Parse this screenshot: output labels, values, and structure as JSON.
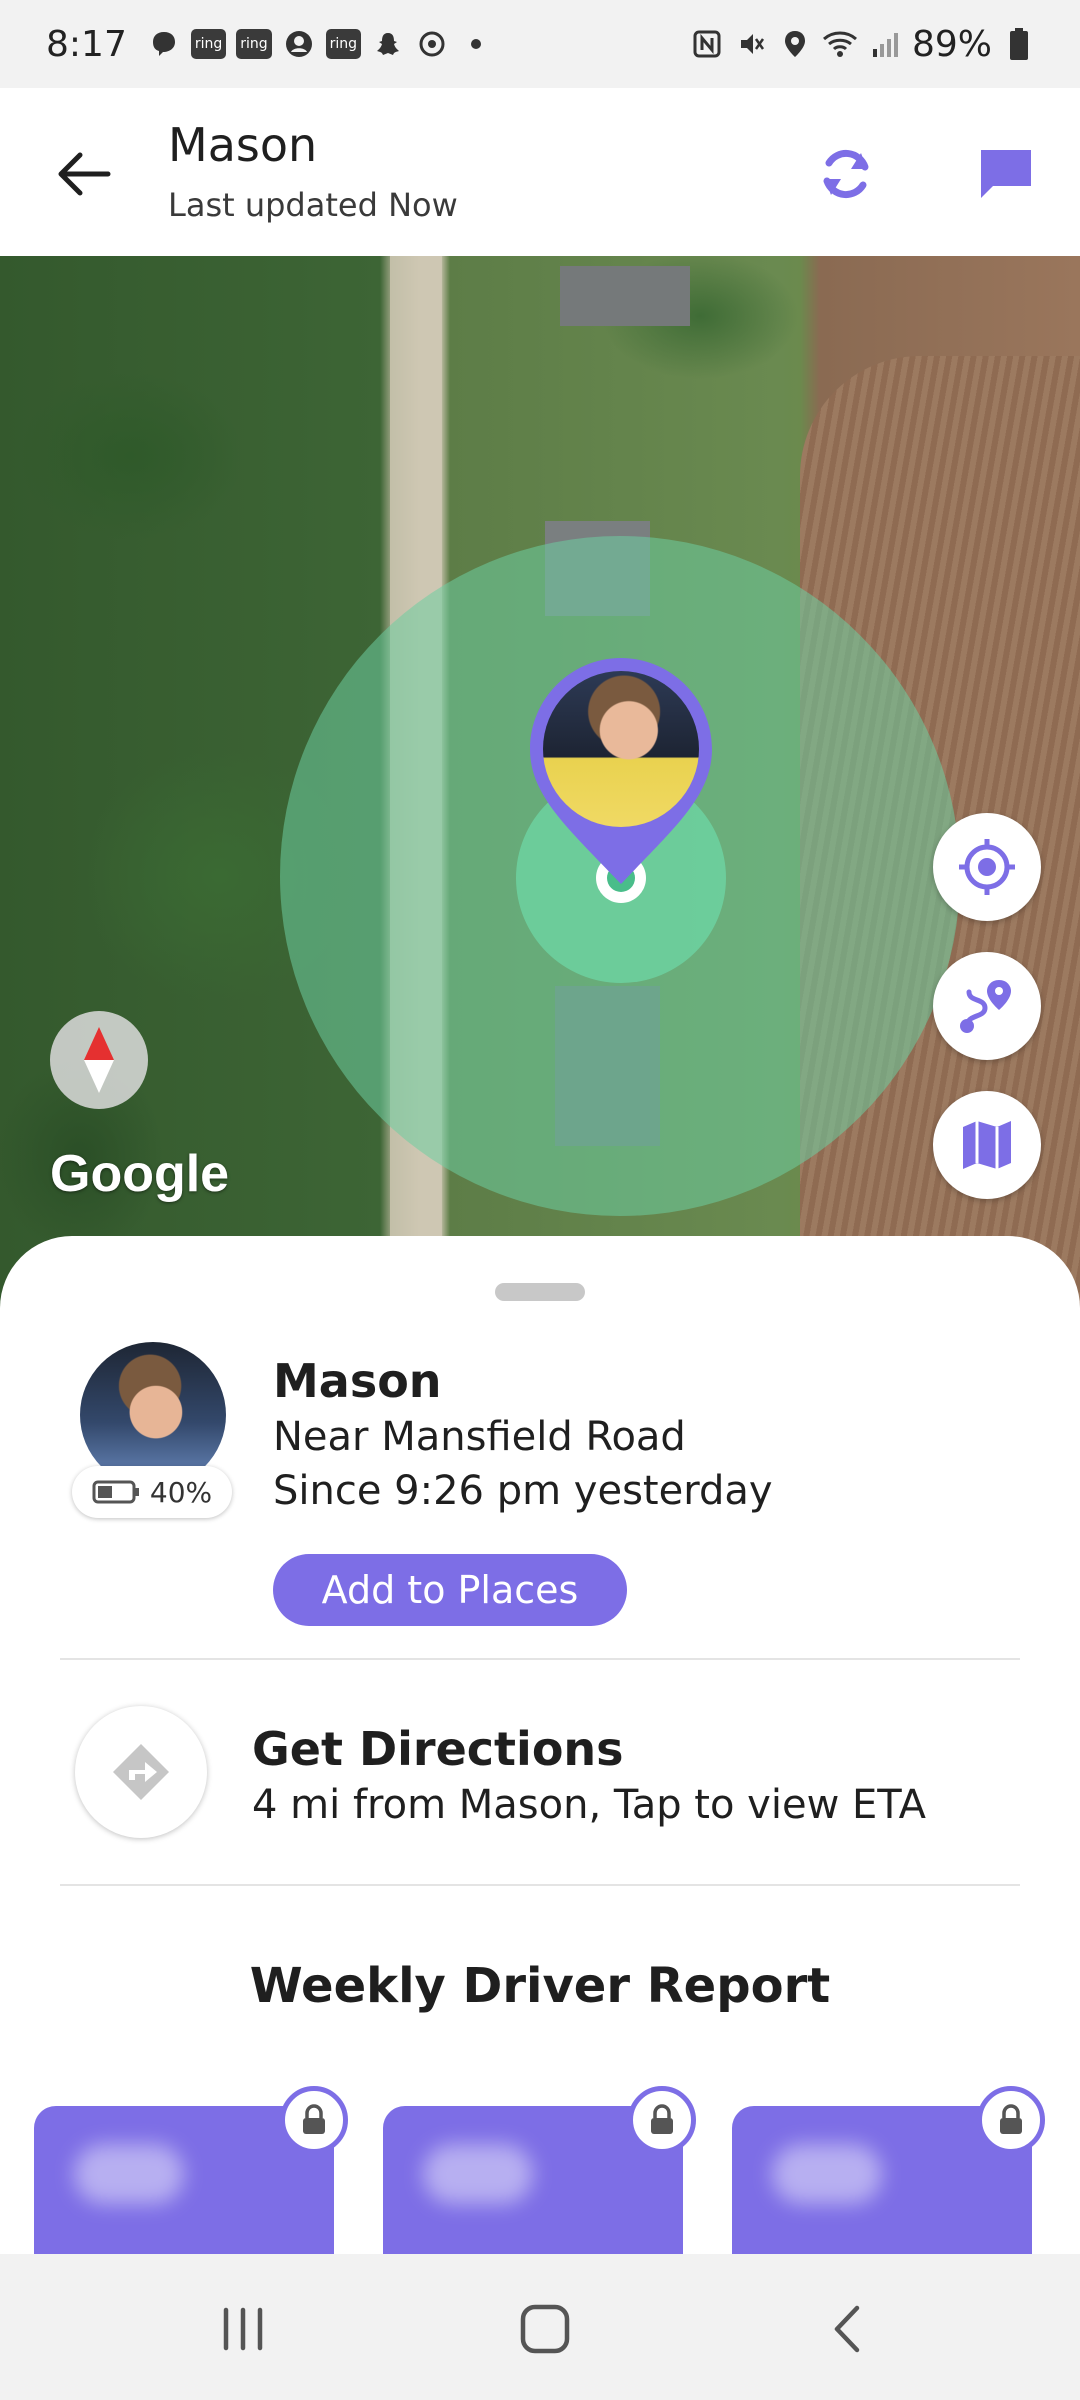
{
  "status_bar": {
    "time": "8:17",
    "ring_labels": [
      "ring",
      "ring",
      "ring"
    ],
    "battery_percent": "89%"
  },
  "header": {
    "title": "Mason",
    "subtitle": "Last updated Now"
  },
  "map": {
    "attribution": "Google"
  },
  "member": {
    "name": "Mason",
    "location": "Near Mansfield Road",
    "since": "Since 9:26 pm yesterday",
    "battery": "40%",
    "add_to_places_label": "Add to Places"
  },
  "directions": {
    "title": "Get Directions",
    "subtitle": "4 mi from Mason, Tap to view ETA"
  },
  "report": {
    "title": "Weekly Driver Report"
  },
  "colors": {
    "accent": "#7d6ee6",
    "accuracy": "#6ecda0"
  }
}
